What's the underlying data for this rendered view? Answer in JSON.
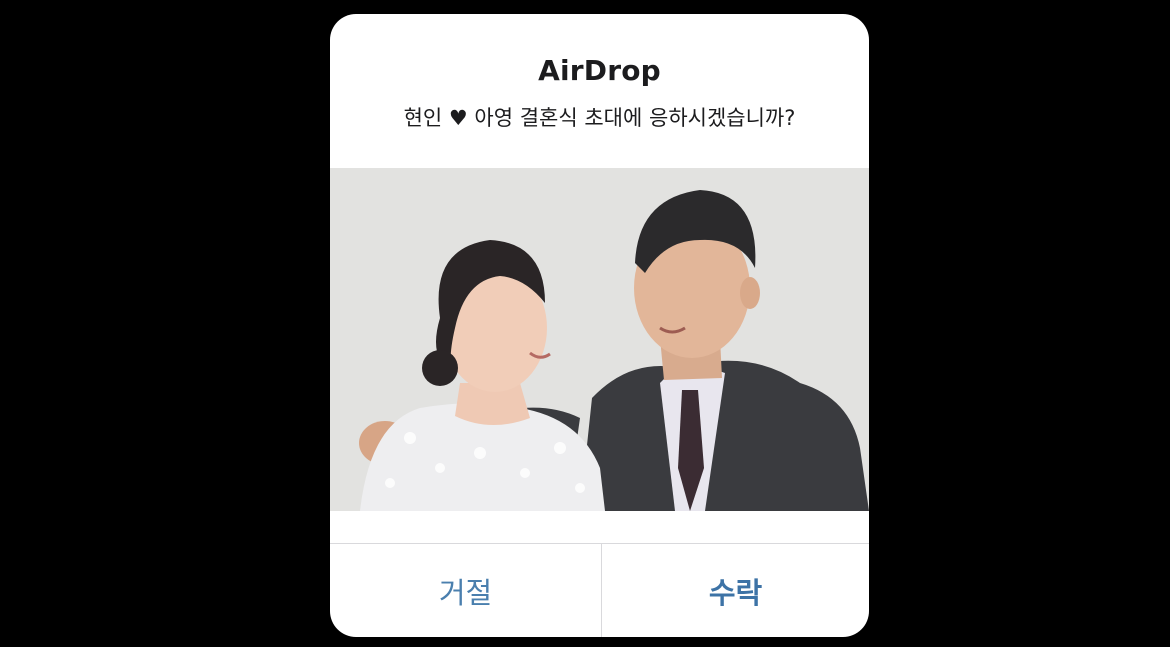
{
  "dialog": {
    "title": "AirDrop",
    "message": "현인 ♥ 아영 결혼식 초대에 응하시겠습니까?"
  },
  "photo": {
    "description_icon": "wedding-photo"
  },
  "buttons": {
    "decline_label": "거절",
    "accept_label": "수락"
  },
  "colors": {
    "background": "#000000",
    "dialog": "#ffffff",
    "button_text": "#4a7fae",
    "divider": "#d9d9dc"
  }
}
